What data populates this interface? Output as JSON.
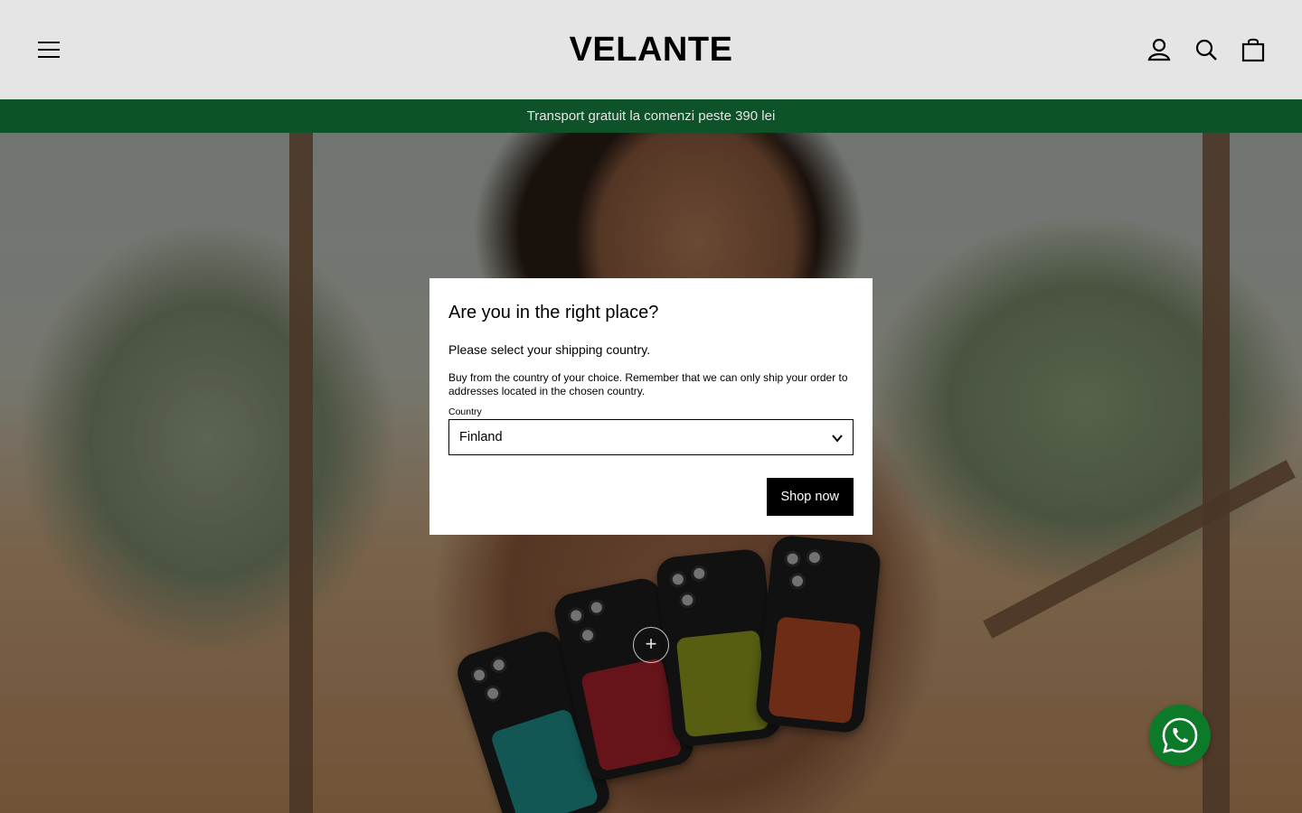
{
  "header": {
    "logo": "VELANTE",
    "menu_icon": "hamburger-menu-icon",
    "account_icon": "user-icon",
    "search_icon": "search-icon",
    "cart_icon": "shopping-bag-icon"
  },
  "announcement": {
    "text": "Transport gratuit la comenzi peste 390 lei"
  },
  "hero": {
    "hotspot_icon": "plus-icon",
    "hotspot_label": "+"
  },
  "modal": {
    "title": "Are you in the right place?",
    "subtitle": "Please select your shipping country.",
    "note": "Buy from the country of your choice. Remember that we can only ship your order to addresses located in the chosen country.",
    "country_label": "Country",
    "country_value": "Finland",
    "submit_label": "Shop now"
  },
  "whatsapp": {
    "icon": "whatsapp-icon"
  },
  "colors": {
    "announcement_bg": "#0f5c2e",
    "whatsapp_bg": "#0d7a2a",
    "button_bg": "#000000"
  }
}
